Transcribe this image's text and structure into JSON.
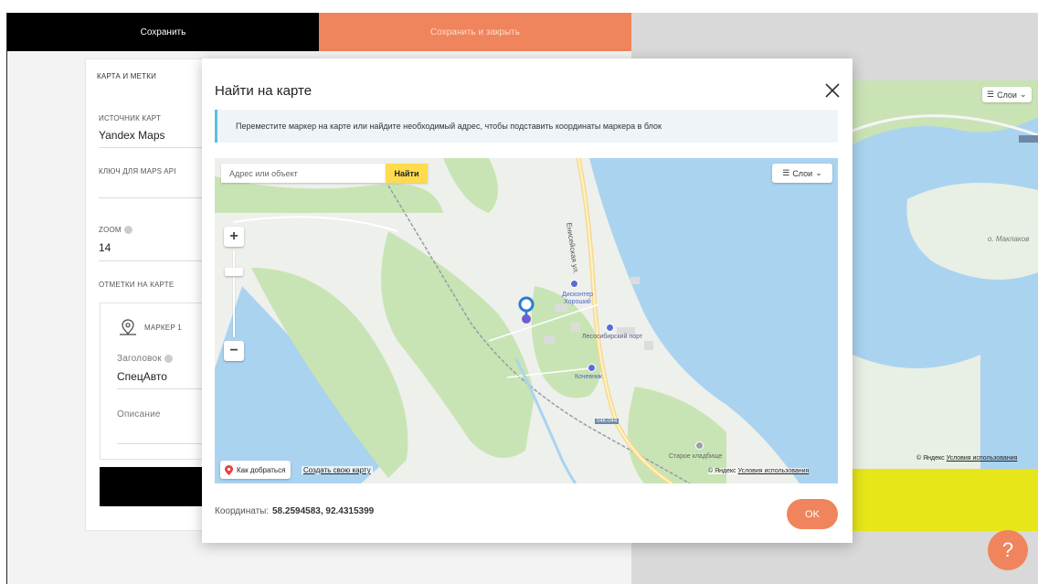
{
  "topbar": {
    "save_label": "Сохранить",
    "save_close_label": "Сохранить и закрыть"
  },
  "editor": {
    "section_title": "КАРТА И МЕТКИ",
    "map_source_label": "ИСТОЧНИК КАРТ",
    "map_source_value": "Yandex Maps",
    "api_key_label": "КЛЮЧ ДЛЯ MAPS API",
    "zoom_label": "ZOOM",
    "zoom_value": "14",
    "markers_label": "ОТМЕТКИ НА КАРТЕ",
    "marker": {
      "title": "МАРКЕР 1",
      "heading_label": "Заголовок",
      "heading_value": "СпецАвто",
      "description_label": "Описание"
    }
  },
  "preview": {
    "layers_label": "Слои",
    "place_label": "о. Маклаков",
    "copyright_prefix": "© Яндекс",
    "terms_link": "Условия использования"
  },
  "help": {
    "icon": "question-icon",
    "label": "?"
  },
  "modal": {
    "title": "Найти на карте",
    "info": "Переместите маркер на карте или найдите необходимый адрес, чтобы подставить координаты маркера в блок",
    "search_placeholder": "Адрес или объект",
    "search_button": "Найти",
    "layers_label": "Слои",
    "zoom_in": "+",
    "zoom_out": "−",
    "route_label": "Как добраться",
    "create_map_label": "Создать свою карту",
    "copyright_prefix": "© Яндекс",
    "terms_link": "Условия использования",
    "map_labels": {
      "street": "Енисейская ул.",
      "discounter": "Дисконтер Хороший",
      "port": "Лесосибирский порт",
      "nomad": "Кочевник",
      "cemetery": "Старое кладбище",
      "road": "04К-044"
    },
    "coords_label": "Координаты:",
    "coords_value": "58.2594583, 92.4315399",
    "ok_label": "OK"
  },
  "colors": {
    "accent": "#f0845c",
    "yellow": "#e6e619",
    "water": "#aad3f0",
    "forest": "#c8e4b4"
  }
}
